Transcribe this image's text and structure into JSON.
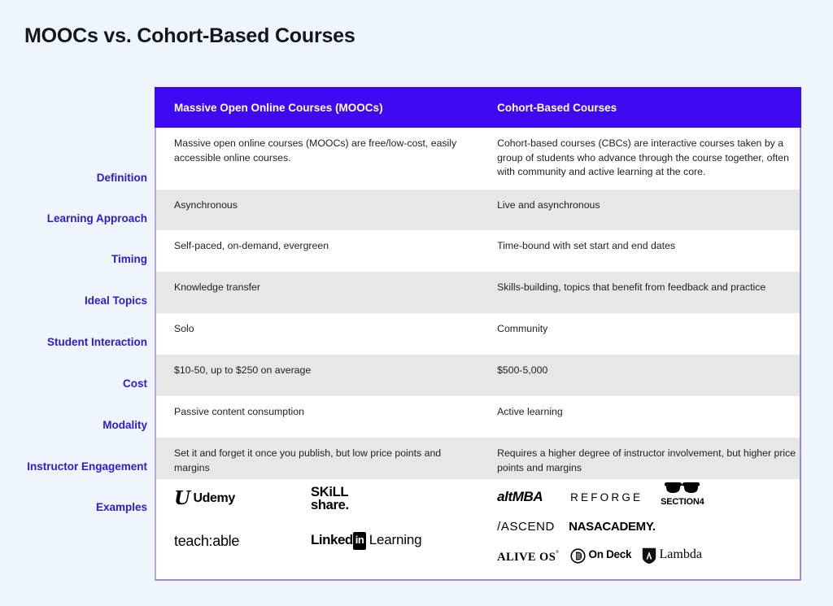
{
  "page": {
    "title": "MOOCs vs. Cohort-Based Courses",
    "background_color": "#eff5fc",
    "accent_color": "#3d0af2",
    "label_color": "#2f1ad4",
    "stripe_color": "#e7e7e7",
    "border_color": "#9b8ad0"
  },
  "table": {
    "columns": [
      "Massive Open Online Courses (MOOCs)",
      "Cohort-Based Courses"
    ],
    "rows": [
      {
        "label": "Definition",
        "mooc": "Massive open online courses (MOOCs) are free/low-cost, easily accessible online courses.",
        "cbc": "Cohort-based courses (CBCs) are interactive courses taken by a group of students who advance through the course together, often with community and active learning at the core."
      },
      {
        "label": "Learning Approach",
        "mooc": "Asynchronous",
        "cbc": "Live and asynchronous"
      },
      {
        "label": "Timing",
        "mooc": "Self-paced, on-demand, evergreen",
        "cbc": "Time-bound with set start and end dates"
      },
      {
        "label": "Ideal Topics",
        "mooc": "Knowledge transfer",
        "cbc": "Skills-building, topics that benefit from feedback and practice"
      },
      {
        "label": "Student Interaction",
        "mooc": "Solo",
        "cbc": "Community"
      },
      {
        "label": "Cost",
        "mooc": "$10-50, up to $250 on average",
        "cbc": "$500-5,000"
      },
      {
        "label": "Modality",
        "mooc": "Passive content consumption",
        "cbc": "Active learning"
      },
      {
        "label": "Instructor Engagement",
        "mooc": "Set it and forget it once you publish, but low price points and margins",
        "cbc": "Requires a higher degree of instructor involvement, but higher price points and margins"
      },
      {
        "label": "Examples",
        "mooc": "",
        "cbc": ""
      }
    ]
  },
  "examples": {
    "label": "Examples",
    "mooc_logos": [
      {
        "name": "udemy",
        "mark": "U",
        "text": "Udemy"
      },
      {
        "name": "skillshare",
        "line1": "SKiLL",
        "line2": "share."
      },
      {
        "name": "teachable",
        "text": "teach:able"
      },
      {
        "name": "linkedin-learning",
        "text1": "Linked",
        "badge": "in",
        "text2": "Learning"
      }
    ],
    "cbc_logos": [
      {
        "name": "altmba",
        "text": "altMBA"
      },
      {
        "name": "reforge",
        "text": "REFORGE"
      },
      {
        "name": "section4",
        "text": "SECTION4",
        "icon": "glasses-icon"
      },
      {
        "name": "ascend",
        "text": "/ASCEND"
      },
      {
        "name": "nasacademy",
        "text": "NASACADEMY."
      },
      {
        "name": "alive-os",
        "text": "ALIVE OS",
        "sup": "°"
      },
      {
        "name": "on-deck",
        "text": "On Deck",
        "icon": "circle-mark-icon"
      },
      {
        "name": "lambda",
        "text": "Lambda",
        "icon": "shield-icon"
      }
    ]
  }
}
